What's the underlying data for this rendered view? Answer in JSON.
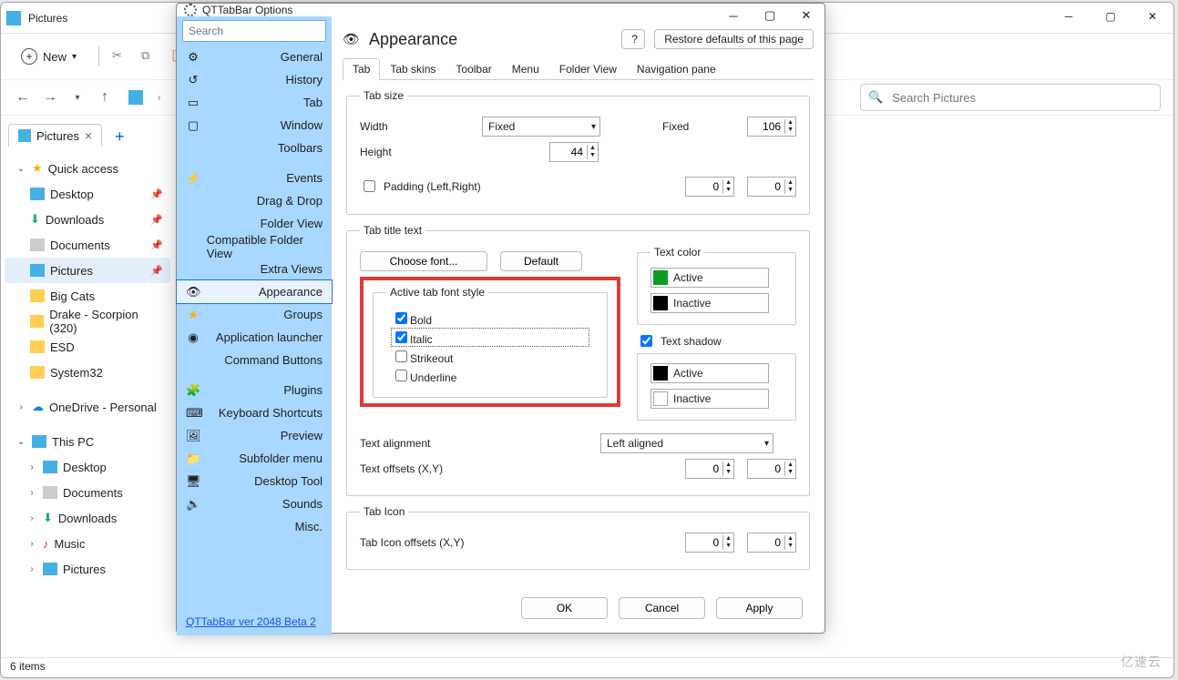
{
  "explorer": {
    "title": "Pictures",
    "new_label": "New",
    "search_placeholder": "Search Pictures",
    "tab": {
      "label": "Pictures"
    },
    "status": "6 items",
    "tree": {
      "quick_access": "Quick access",
      "desktop": "Desktop",
      "downloads": "Downloads",
      "documents": "Documents",
      "pictures": "Pictures",
      "big_cats": "Big Cats",
      "drake": "Drake - Scorpion (320)",
      "esd": "ESD",
      "system32": "System32",
      "onedrive": "OneDrive - Personal",
      "this_pc": "This PC",
      "pc_desktop": "Desktop",
      "pc_documents": "Documents",
      "pc_downloads": "Downloads",
      "pc_music": "Music",
      "pc_pictures": "Pictures"
    }
  },
  "dialog": {
    "title": "QTTabBar Options",
    "header": "Appearance",
    "info_btn": "?",
    "restore_btn": "Restore defaults of this page",
    "search_placeholder": "Search",
    "version_link": "QTTabBar ver 2048 Beta 2",
    "categories": {
      "general": "General",
      "history": "History",
      "tab": "Tab",
      "window": "Window",
      "toolbars": "Toolbars",
      "events": "Events",
      "dragdrop": "Drag & Drop",
      "folderview": "Folder View",
      "compat": "Compatible Folder View",
      "extra": "Extra Views",
      "appearance": "Appearance",
      "groups": "Groups",
      "applauncher": "Application launcher",
      "cmdbtn": "Command Buttons",
      "plugins": "Plugins",
      "keyboard": "Keyboard Shortcuts",
      "preview": "Preview",
      "subfolder": "Subfolder menu",
      "desktop": "Desktop Tool",
      "sounds": "Sounds",
      "misc": "Misc."
    },
    "subtabs": {
      "tab": "Tab",
      "tabskins": "Tab skins",
      "toolbar": "Toolbar",
      "menu": "Menu",
      "folderview": "Folder View",
      "navpane": "Navigation pane"
    },
    "tabsize": {
      "legend": "Tab size",
      "width_lbl": "Width",
      "width_mode": "Fixed",
      "fixed_lbl": "Fixed",
      "fixed_val": "106",
      "height_lbl": "Height",
      "height_val": "44",
      "padding_lbl": "Padding (Left,Right)",
      "pad_l": "0",
      "pad_r": "0"
    },
    "tabtitle": {
      "legend": "Tab title text",
      "choose_font": "Choose font...",
      "default_btn": "Default",
      "active_font_legend": "Active tab font style",
      "bold": "Bold",
      "italic": "Italic",
      "strikeout": "Strikeout",
      "underline": "Underline",
      "textcolor_legend": "Text color",
      "active": "Active",
      "inactive": "Inactive",
      "shadow_lbl": "Text shadow",
      "shadow_active": "Active",
      "shadow_inactive": "Inactive",
      "align_lbl": "Text alignment",
      "align_val": "Left aligned",
      "offsets_lbl": "Text offsets (X,Y)",
      "ox": "0",
      "oy": "0"
    },
    "tabicon": {
      "legend": "Tab Icon",
      "offsets_lbl": "Tab Icon offsets (X,Y)",
      "ix": "0",
      "iy": "0"
    },
    "buttons": {
      "ok": "OK",
      "cancel": "Cancel",
      "apply": "Apply"
    },
    "colors": {
      "active": "#0b9c26",
      "inactive": "#000000",
      "shadow_active": "#000000",
      "shadow_inactive": "#ffffff"
    }
  },
  "watermark": "亿速云"
}
